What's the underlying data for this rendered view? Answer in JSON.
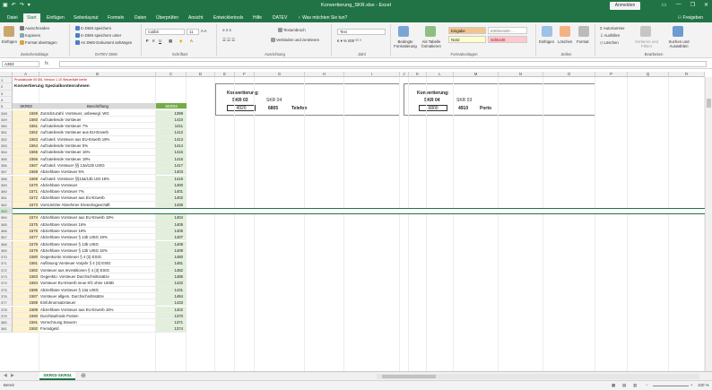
{
  "window": {
    "title": "Konvertierung_SKR.xlsx  -  Excel",
    "signin": "Anmelden",
    "share": "Freigeben"
  },
  "tabs": [
    "Datei",
    "Start",
    "Einfügen",
    "Seitenlayout",
    "Formeln",
    "Daten",
    "Überprüfen",
    "Ansicht",
    "Entwicklertools",
    "Hilfe",
    "DATEV",
    "Was möchten Sie tun?"
  ],
  "ribbon": {
    "clipboard": {
      "paste": "Einfügen",
      "cut": "Ausschneiden",
      "copy": "Kopieren",
      "format_painter": "Format übertragen",
      "caption": "Zwischenablage"
    },
    "datev_dms": {
      "b1": "In DMS speichern",
      "b2": "In DMS speichern unter",
      "b3": "An DMS-Dokument anhängen",
      "caption": "DATEV DMS"
    },
    "font": {
      "name": "Calibri",
      "size": "11",
      "caption": "Schriftart"
    },
    "alignment": {
      "wrap": "Textumbruch",
      "merge": "Verbinden und zentrieren",
      "caption": "Ausrichtung"
    },
    "number": {
      "format": "Text",
      "caption": "Zahl"
    },
    "styles": {
      "conditional": "Bedingte Formatierung",
      "table": "Als Tabelle formatieren",
      "s1": "Eingabe",
      "s2": "Erklärender ...",
      "s3": "Notiz",
      "s4": "Schlecht",
      "caption": "Formatvorlagen"
    },
    "cells": {
      "insert": "Einfügen",
      "delete": "Löschen",
      "format": "Format",
      "caption": "Zellen"
    },
    "editing": {
      "autosum": "AutoSumme",
      "fill": "Ausfüllen",
      "clear": "Löschen",
      "sort": "Sortieren und Filtern",
      "find": "Suchen und Auswählen",
      "caption": "Bearbeiten"
    }
  },
  "formula_bar": {
    "name_box": "A363",
    "fx": "fx",
    "formula": ""
  },
  "columns": [
    "A",
    "B",
    "C",
    "D",
    "E",
    "F",
    "G",
    "H",
    "I",
    "J",
    "K",
    "L",
    "M",
    "N",
    "O",
    "P",
    "Q",
    "R"
  ],
  "header_rows": [
    {
      "num": "1",
      "text": "Produktcode 00.00L Version 1.10 Steuerklärt berlin"
    },
    {
      "num": "2",
      "text": "Konvertierung Spezialkontenrahmen"
    },
    {
      "num": "3",
      "text": ""
    },
    {
      "num": "4",
      "text": ""
    },
    {
      "num": "5",
      "text": ""
    }
  ],
  "table_header": {
    "col_a": "SKR03",
    "col_b": "Beschriftung",
    "col_c": "SKR04"
  },
  "konv1": {
    "title": "Konvertierung:",
    "from_label": "SKR 03",
    "to_label": "SKR 04",
    "input": "4920",
    "result": "6805",
    "text": "Telefon"
  },
  "konv2": {
    "title": "Konvertierung:",
    "from_label": "SKR 04",
    "to_label": "SKR 03",
    "input": "6800",
    "result": "4910",
    "text": "Porto"
  },
  "rows": [
    {
      "num": "348",
      "a": "1559",
      "b": "Zurückzuzahl. Vorsteuer, unbewegl. WG",
      "c": "1399"
    },
    {
      "num": "349",
      "a": "1560",
      "b": "Aufzuteilende Vorsteuer",
      "c": "1410"
    },
    {
      "num": "350",
      "a": "1561",
      "b": "Aufzuteilende Vorsteuer 7%",
      "c": "1411"
    },
    {
      "num": "351",
      "a": "1562",
      "b": "Aufzuteilende Vorsteuer aus EU-Erwerb",
      "c": "1412"
    },
    {
      "num": "352",
      "a": "1563",
      "b": "Aufzuteil. Vorsteuer aus EU-Erwerb 19%",
      "c": "1413"
    },
    {
      "num": "353",
      "a": "1564",
      "b": "Aufzuteilende Vorsteuer 5%",
      "c": "1414"
    },
    {
      "num": "354",
      "a": "1565",
      "b": "Aufzuteilende Vorsteuer 16%",
      "c": "1415"
    },
    {
      "num": "355",
      "a": "1566",
      "b": "Aufzuteilende Vorsteuer 19%",
      "c": "1416"
    },
    {
      "num": "356",
      "a": "1567",
      "b": "Aufzuteil. Vorsteuer §§ 13a/13b UStG",
      "c": "1417"
    },
    {
      "num": "357",
      "a": "1568",
      "b": "Abziehbare Vorsteuer 5%",
      "c": "1403"
    },
    {
      "num": "358",
      "a": "1569",
      "b": "Aufzuteil. Vorsteuer §§13a/13b USt 19%",
      "c": "1419"
    },
    {
      "num": "359",
      "a": "1570",
      "b": "Abziehbare Vorsteuer",
      "c": "1400"
    },
    {
      "num": "360",
      "a": "1571",
      "b": "Abziehbare Vorsteuer 7%",
      "c": "1401"
    },
    {
      "num": "361",
      "a": "1572",
      "b": "Abziehbare Vorsteuer aus EU-Erwerb",
      "c": "1402"
    },
    {
      "num": "362",
      "a": "1573",
      "b": "Vorst.letzter Abnehmer Dreiecksgeschäft",
      "c": "1436"
    },
    {
      "num": "363",
      "a": "",
      "b": "",
      "c": ""
    },
    {
      "num": "364",
      "a": "1574",
      "b": "Abziehbare Vorsteuer aus EU-Erwerb 19%",
      "c": "1404"
    },
    {
      "num": "365",
      "a": "1575",
      "b": "Abziehbare Vorsteuer 16%",
      "c": "1405"
    },
    {
      "num": "366",
      "a": "1576",
      "b": "Abziehbare Vorsteuer 19%",
      "c": "1406"
    },
    {
      "num": "367",
      "a": "1577",
      "b": "Abziehbare Vorsteuer § 13b UStG 19%",
      "c": "1407"
    },
    {
      "num": "368",
      "a": "1578",
      "b": "Abziehbare Vorsteuer § 13b UStG",
      "c": "1408"
    },
    {
      "num": "369",
      "a": "1579",
      "b": "Abziehbare Vorsteuer § 13b UStG 16%",
      "c": "1409"
    },
    {
      "num": "370",
      "a": "1580",
      "b": "Gegenkonto Vorsteuer § 4 (3) EStG",
      "c": "1480"
    },
    {
      "num": "371",
      "a": "1581",
      "b": "Auflösung Vorsteuer Vorjahr § 4 (3) EStG",
      "c": "1481"
    },
    {
      "num": "372",
      "a": "1582",
      "b": "Vorsteuer aus Investitionen § 4 (3) EStG",
      "c": "1482"
    },
    {
      "num": "373",
      "a": "1583",
      "b": "Gegenkto. Vorsteuer Durchschnittssätze",
      "c": "1485"
    },
    {
      "num": "374",
      "a": "1584",
      "b": "Vorsteuer EU-Erwerb neue Kfz ohne UStID",
      "c": "1432"
    },
    {
      "num": "375",
      "a": "1585",
      "b": "Abziehbare Vorsteuer § 13a UStG",
      "c": "1431"
    },
    {
      "num": "376",
      "a": "1587",
      "b": "Vorsteuer allgem. Durchschnittssätze",
      "c": "1484"
    },
    {
      "num": "377",
      "a": "1588",
      "b": "Einfuhrumsatzsteuer",
      "c": "1433"
    },
    {
      "num": "378",
      "a": "1589",
      "b": "Abziehbare Vorsteuer aus EU-Erwerb 16%",
      "c": "1402"
    },
    {
      "num": "379",
      "a": "1590",
      "b": "Durchlaufende Posten",
      "c": "1370"
    },
    {
      "num": "380",
      "a": "1591",
      "b": "Verrechnung Steuern",
      "c": "1371"
    },
    {
      "num": "381",
      "a": "1592",
      "b": "Fremdgeld",
      "c": "1374"
    }
  ],
  "sheet_tab": "SKR03-SKR04",
  "status": {
    "ready": "Bereit",
    "zoom": "100 %"
  }
}
